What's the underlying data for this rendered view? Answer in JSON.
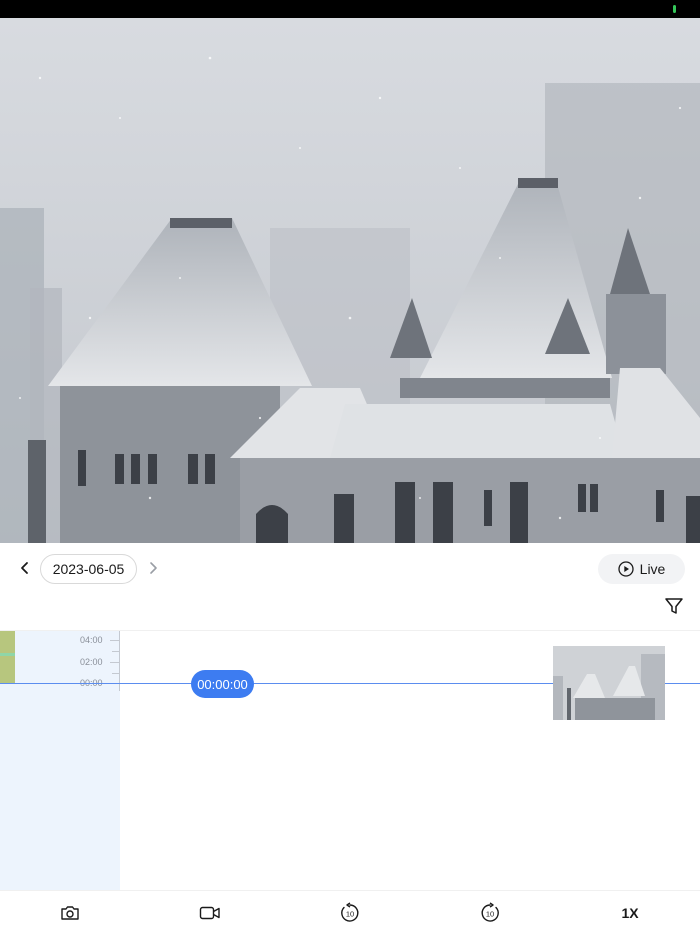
{
  "datebar": {
    "date": "2023-06-05",
    "live_label": "Live"
  },
  "timeline": {
    "ticks": [
      "04:00",
      "02:00",
      "00:00"
    ],
    "current_time": "00:00:00"
  },
  "toolbar": {
    "speed_label": "1X",
    "rewind_label": "10",
    "forward_label": "10"
  },
  "icons": [
    "chevron-left-icon",
    "chevron-right-icon",
    "play-icon",
    "filter-icon",
    "camera-icon",
    "video-record-icon",
    "rewind-10-icon",
    "forward-10-icon"
  ],
  "colors": {
    "accent": "#3d7cf1",
    "ruler_bg": "#edf4fd",
    "recording": "#b7c67e"
  }
}
